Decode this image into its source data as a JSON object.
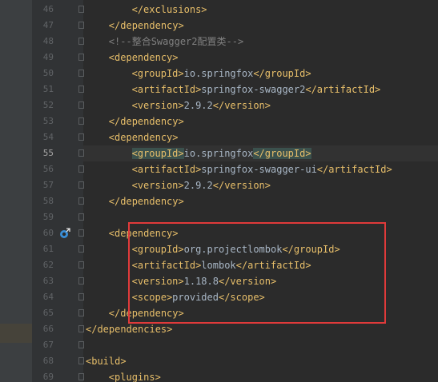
{
  "colors": {
    "background": "#2b2b2b",
    "gutter": "#313335",
    "tag": "#e8bf6a",
    "text": "#a9b7c6",
    "comment": "#808080",
    "line_number": "#606366",
    "highlight_box": "#e03a3a"
  },
  "gutter_icon": "override-method-icon",
  "lines": [
    {
      "num": "46",
      "indent": 4,
      "parts": [
        {
          "t": "</exclusions>",
          "c": "tag"
        }
      ]
    },
    {
      "num": "47",
      "indent": 3,
      "parts": [
        {
          "t": "</dependency>",
          "c": "tag"
        }
      ]
    },
    {
      "num": "48",
      "indent": 3,
      "parts": [
        {
          "t": "<!--整合Swagger2配置类-->",
          "c": "comment"
        }
      ]
    },
    {
      "num": "49",
      "indent": 3,
      "parts": [
        {
          "t": "<dependency>",
          "c": "tag"
        }
      ]
    },
    {
      "num": "50",
      "indent": 4,
      "parts": [
        {
          "t": "<groupId>",
          "c": "tag"
        },
        {
          "t": "io.springfox",
          "c": "plain"
        },
        {
          "t": "</groupId>",
          "c": "tag"
        }
      ]
    },
    {
      "num": "51",
      "indent": 4,
      "parts": [
        {
          "t": "<artifactId>",
          "c": "tag"
        },
        {
          "t": "springfox-swagger2",
          "c": "plain"
        },
        {
          "t": "</artifactId>",
          "c": "tag"
        }
      ]
    },
    {
      "num": "52",
      "indent": 4,
      "parts": [
        {
          "t": "<version>",
          "c": "tag"
        },
        {
          "t": "2.9.2",
          "c": "plain"
        },
        {
          "t": "</version>",
          "c": "tag"
        }
      ]
    },
    {
      "num": "53",
      "indent": 3,
      "parts": [
        {
          "t": "</dependency>",
          "c": "tag"
        }
      ]
    },
    {
      "num": "54",
      "indent": 3,
      "parts": [
        {
          "t": "<dependency>",
          "c": "tag"
        }
      ]
    },
    {
      "num": "55",
      "indent": 4,
      "current": true,
      "parts": [
        {
          "t": "<groupId>",
          "c": "tag match"
        },
        {
          "t": "io.springfox",
          "c": "plain"
        },
        {
          "t": "</groupId>",
          "c": "tag match"
        }
      ]
    },
    {
      "num": "56",
      "indent": 4,
      "parts": [
        {
          "t": "<artifactId>",
          "c": "tag"
        },
        {
          "t": "springfox-swagger-ui",
          "c": "plain"
        },
        {
          "t": "</artifactId>",
          "c": "tag"
        }
      ]
    },
    {
      "num": "57",
      "indent": 4,
      "parts": [
        {
          "t": "<version>",
          "c": "tag"
        },
        {
          "t": "2.9.2",
          "c": "plain"
        },
        {
          "t": "</version>",
          "c": "tag"
        }
      ]
    },
    {
      "num": "58",
      "indent": 3,
      "parts": [
        {
          "t": "</dependency>",
          "c": "tag"
        }
      ]
    },
    {
      "num": "59",
      "indent": 3,
      "parts": []
    },
    {
      "num": "60",
      "indent": 3,
      "icon": true,
      "parts": [
        {
          "t": "<dependency>",
          "c": "tag"
        }
      ]
    },
    {
      "num": "61",
      "indent": 4,
      "parts": [
        {
          "t": "<groupId>",
          "c": "tag"
        },
        {
          "t": "org.projectlombok",
          "c": "plain"
        },
        {
          "t": "</groupId>",
          "c": "tag"
        }
      ]
    },
    {
      "num": "62",
      "indent": 4,
      "parts": [
        {
          "t": "<artifactId>",
          "c": "tag"
        },
        {
          "t": "lombok",
          "c": "plain"
        },
        {
          "t": "</artifactId>",
          "c": "tag"
        }
      ]
    },
    {
      "num": "63",
      "indent": 4,
      "parts": [
        {
          "t": "<version>",
          "c": "tag"
        },
        {
          "t": "1.18.8",
          "c": "plain"
        },
        {
          "t": "</version>",
          "c": "tag"
        }
      ]
    },
    {
      "num": "64",
      "indent": 4,
      "parts": [
        {
          "t": "<scope>",
          "c": "tag"
        },
        {
          "t": "provided",
          "c": "plain"
        },
        {
          "t": "</scope>",
          "c": "tag"
        }
      ]
    },
    {
      "num": "65",
      "indent": 3,
      "parts": [
        {
          "t": "</dependency>",
          "c": "tag"
        }
      ]
    },
    {
      "num": "66",
      "indent": 2,
      "parts": [
        {
          "t": "</dependencies>",
          "c": "tag"
        }
      ]
    },
    {
      "num": "67",
      "indent": 2,
      "parts": []
    },
    {
      "num": "68",
      "indent": 2,
      "parts": [
        {
          "t": "<build>",
          "c": "tag"
        }
      ]
    },
    {
      "num": "69",
      "indent": 3,
      "parts": [
        {
          "t": "<plugins>",
          "c": "tag"
        }
      ]
    }
  ]
}
